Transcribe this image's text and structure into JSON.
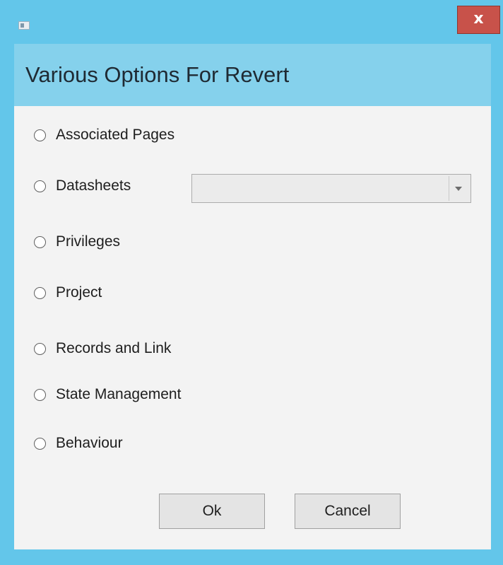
{
  "window": {
    "close_glyph": "x",
    "title_icon": "app-window-icon",
    "accent_color": "#63c6ea",
    "close_color": "#c8524a"
  },
  "dialog": {
    "title": "Various Options For Revert"
  },
  "options": [
    {
      "label": "Associated Pages",
      "selected": false
    },
    {
      "label": "Datasheets",
      "selected": false
    },
    {
      "label": "Privileges",
      "selected": false
    },
    {
      "label": "Project",
      "selected": false
    },
    {
      "label": "Records and Link",
      "selected": false
    },
    {
      "label": "State Management",
      "selected": false
    },
    {
      "label": "Behaviour",
      "selected": false
    }
  ],
  "datasheet_combo": {
    "value": "",
    "arrow_icon": "chevron-down-icon"
  },
  "buttons": {
    "ok": "Ok",
    "cancel": "Cancel"
  }
}
